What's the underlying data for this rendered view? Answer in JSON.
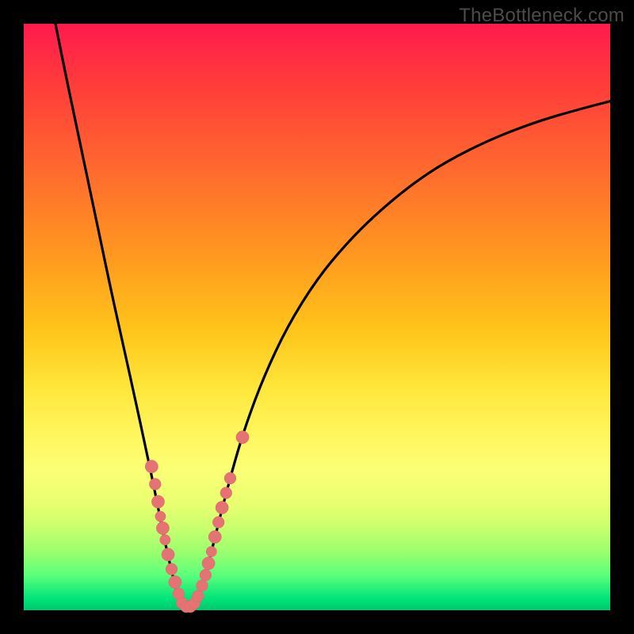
{
  "watermark": "TheBottleneck.com",
  "colors": {
    "frame": "#000000",
    "curve": "#000000",
    "marker_fill": "#e57373",
    "marker_stroke": "#d96a6a"
  },
  "chart_data": {
    "type": "line",
    "title": "",
    "xlabel": "",
    "ylabel": "",
    "xlim": [
      0,
      100
    ],
    "ylim": [
      0,
      100
    ],
    "grid": false,
    "legend": false,
    "note": "V-shaped curve; y-axis represents bottleneck % (0 = no bottleneck at green bottom, 100 = severe at red top). Minimum near x≈27.",
    "curve_points": [
      {
        "x": 5.4,
        "y": 100.0
      },
      {
        "x": 7.0,
        "y": 92.0
      },
      {
        "x": 9.0,
        "y": 82.5
      },
      {
        "x": 11.0,
        "y": 73.0
      },
      {
        "x": 13.0,
        "y": 63.5
      },
      {
        "x": 15.0,
        "y": 54.0
      },
      {
        "x": 17.0,
        "y": 45.0
      },
      {
        "x": 19.0,
        "y": 36.0
      },
      {
        "x": 20.5,
        "y": 29.0
      },
      {
        "x": 22.0,
        "y": 22.0
      },
      {
        "x": 23.0,
        "y": 17.0
      },
      {
        "x": 24.0,
        "y": 12.0
      },
      {
        "x": 25.0,
        "y": 7.5
      },
      {
        "x": 26.0,
        "y": 3.5
      },
      {
        "x": 27.0,
        "y": 1.0
      },
      {
        "x": 28.0,
        "y": 0.5
      },
      {
        "x": 29.0,
        "y": 1.0
      },
      {
        "x": 30.0,
        "y": 3.0
      },
      {
        "x": 31.0,
        "y": 6.0
      },
      {
        "x": 32.0,
        "y": 10.0
      },
      {
        "x": 33.0,
        "y": 14.0
      },
      {
        "x": 34.0,
        "y": 18.0
      },
      {
        "x": 36.0,
        "y": 25.5
      },
      {
        "x": 38.0,
        "y": 32.0
      },
      {
        "x": 41.0,
        "y": 40.0
      },
      {
        "x": 45.0,
        "y": 48.5
      },
      {
        "x": 50.0,
        "y": 56.5
      },
      {
        "x": 55.0,
        "y": 62.5
      },
      {
        "x": 60.0,
        "y": 67.5
      },
      {
        "x": 66.0,
        "y": 72.5
      },
      {
        "x": 72.0,
        "y": 76.5
      },
      {
        "x": 80.0,
        "y": 80.5
      },
      {
        "x": 88.0,
        "y": 83.5
      },
      {
        "x": 95.0,
        "y": 85.5
      },
      {
        "x": 100.0,
        "y": 86.8
      }
    ],
    "markers": [
      {
        "x": 21.8,
        "y": 24.5,
        "r": 1.1
      },
      {
        "x": 22.4,
        "y": 21.5,
        "r": 1.0
      },
      {
        "x": 22.9,
        "y": 18.5,
        "r": 1.1
      },
      {
        "x": 23.3,
        "y": 16.0,
        "r": 0.9
      },
      {
        "x": 23.7,
        "y": 14.0,
        "r": 1.1
      },
      {
        "x": 24.1,
        "y": 12.0,
        "r": 0.9
      },
      {
        "x": 24.6,
        "y": 9.5,
        "r": 1.1
      },
      {
        "x": 25.2,
        "y": 7.0,
        "r": 1.0
      },
      {
        "x": 25.8,
        "y": 4.8,
        "r": 1.1
      },
      {
        "x": 26.4,
        "y": 2.8,
        "r": 1.0
      },
      {
        "x": 27.0,
        "y": 1.2,
        "r": 1.0
      },
      {
        "x": 27.7,
        "y": 0.6,
        "r": 1.0
      },
      {
        "x": 28.4,
        "y": 0.6,
        "r": 1.0
      },
      {
        "x": 29.1,
        "y": 1.2,
        "r": 1.0
      },
      {
        "x": 29.7,
        "y": 2.4,
        "r": 1.0
      },
      {
        "x": 30.4,
        "y": 4.2,
        "r": 1.0
      },
      {
        "x": 31.0,
        "y": 6.0,
        "r": 1.0
      },
      {
        "x": 31.5,
        "y": 8.0,
        "r": 1.1
      },
      {
        "x": 32.0,
        "y": 10.0,
        "r": 0.9
      },
      {
        "x": 32.6,
        "y": 12.5,
        "r": 1.1
      },
      {
        "x": 33.2,
        "y": 15.0,
        "r": 1.0
      },
      {
        "x": 33.8,
        "y": 17.5,
        "r": 1.1
      },
      {
        "x": 34.5,
        "y": 20.0,
        "r": 1.0
      },
      {
        "x": 35.2,
        "y": 22.5,
        "r": 1.0
      },
      {
        "x": 37.3,
        "y": 29.5,
        "r": 1.1
      }
    ]
  }
}
